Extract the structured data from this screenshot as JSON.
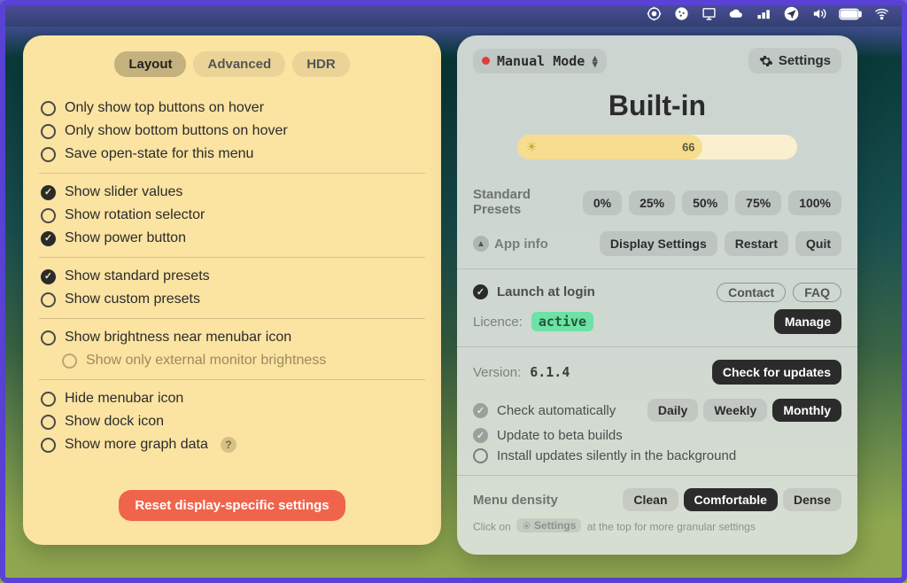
{
  "menubar_icons": [
    "location",
    "globe",
    "display",
    "cloud",
    "battery-bars",
    "send",
    "volume",
    "battery",
    "wifi"
  ],
  "left": {
    "tabs": {
      "layout": "Layout",
      "advanced": "Advanced",
      "hdr": "HDR",
      "active": "layout"
    },
    "groups": [
      {
        "items": [
          {
            "id": "top-hover",
            "label": "Only show top buttons on hover",
            "checked": false
          },
          {
            "id": "bottom-hover",
            "label": "Only show bottom buttons on hover",
            "checked": false
          },
          {
            "id": "save-open",
            "label": "Save open-state for this menu",
            "checked": false
          }
        ]
      },
      {
        "items": [
          {
            "id": "slider-values",
            "label": "Show slider values",
            "checked": true
          },
          {
            "id": "rotation",
            "label": "Show rotation selector",
            "checked": false
          },
          {
            "id": "power",
            "label": "Show power button",
            "checked": true
          }
        ]
      },
      {
        "items": [
          {
            "id": "std-presets",
            "label": "Show standard presets",
            "checked": true
          },
          {
            "id": "cust-presets",
            "label": "Show custom presets",
            "checked": false
          }
        ]
      },
      {
        "items": [
          {
            "id": "brightness-near",
            "label": "Show brightness near menubar icon",
            "checked": false
          },
          {
            "id": "external-only",
            "label": "Show only external monitor brightness",
            "checked": false,
            "sub": true
          }
        ]
      },
      {
        "items": [
          {
            "id": "hide-menubar",
            "label": "Hide menubar icon",
            "checked": false
          },
          {
            "id": "dock-icon",
            "label": "Show dock icon",
            "checked": false
          },
          {
            "id": "graph-data",
            "label": "Show more graph data",
            "checked": false,
            "help": true
          }
        ]
      }
    ],
    "reset": "Reset display-specific settings"
  },
  "right": {
    "mode": "Manual Mode",
    "settings_label": "Settings",
    "display_name": "Built-in",
    "brightness": 66,
    "presets_label": "Standard\nPresets",
    "presets": [
      "0%",
      "25%",
      "50%",
      "75%",
      "100%"
    ],
    "app_info": "App info",
    "buttons": {
      "display_settings": "Display Settings",
      "restart": "Restart",
      "quit": "Quit"
    },
    "launch": "Launch at login",
    "contact": "Contact",
    "faq": "FAQ",
    "licence_label": "Licence:",
    "licence_value": "active",
    "manage": "Manage",
    "version_label": "Version:",
    "version": "6.1.4",
    "check_updates": "Check for updates",
    "check_auto": "Check automatically",
    "freq": {
      "daily": "Daily",
      "weekly": "Weekly",
      "monthly": "Monthly",
      "active": "monthly"
    },
    "update_beta": "Update to beta builds",
    "install_silent": "Install updates silently in the background",
    "density_label": "Menu density",
    "density": {
      "clean": "Clean",
      "comfortable": "Comfortable",
      "dense": "Dense",
      "active": "comfortable"
    },
    "hint_pre": "Click on",
    "hint_chip": "Settings",
    "hint_post": "at the top for more granular settings"
  }
}
